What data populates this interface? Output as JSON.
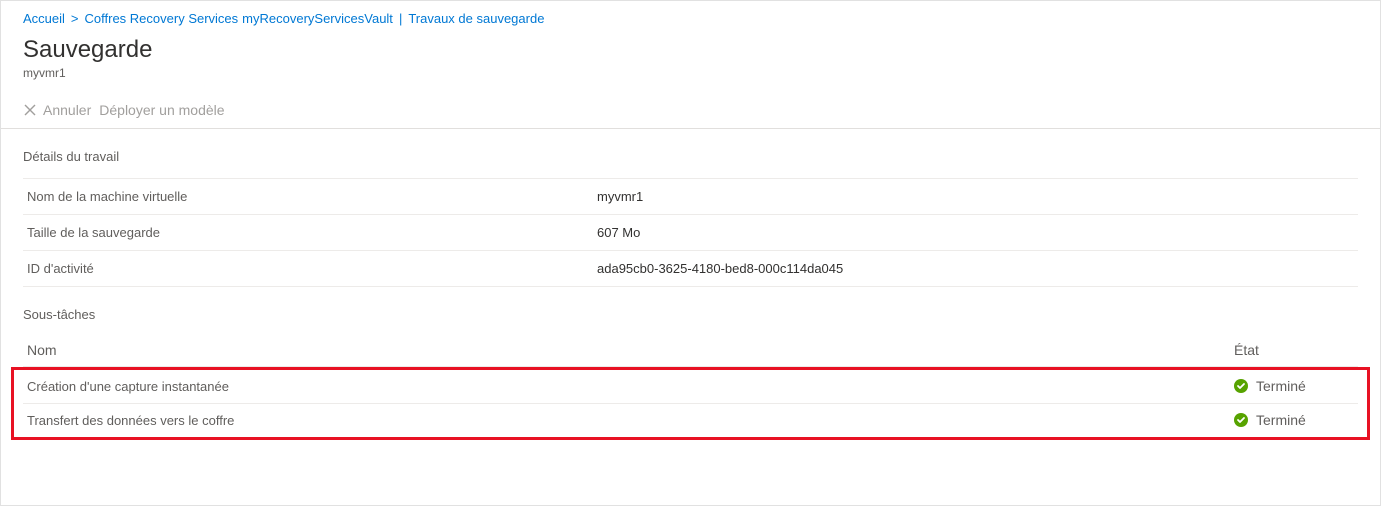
{
  "breadcrumb": {
    "home": "Accueil",
    "vaults": "Coffres Recovery Services",
    "vault_name": "myRecoveryServicesVault",
    "jobs": "Travaux de sauvegarde"
  },
  "page": {
    "title": "Sauvegarde",
    "subtitle": "myvmr1"
  },
  "toolbar": {
    "cancel_label": "Annuler",
    "deploy_template_label": "Déployer un modèle"
  },
  "details": {
    "section_title": "Détails du travail",
    "rows": [
      {
        "label": "Nom de la machine virtuelle",
        "value": "myvmr1"
      },
      {
        "label": "Taille de la sauvegarde",
        "value": "607 Mo"
      },
      {
        "label": "ID d'activité",
        "value": "ada95cb0-3625-4180-bed8-000c114da045"
      }
    ]
  },
  "subtasks": {
    "section_title": "Sous-tâches",
    "col_name": "Nom",
    "col_state": "État",
    "rows": [
      {
        "name": "Création d'une capture instantanée",
        "state": "Terminé"
      },
      {
        "name": "Transfert des données vers le coffre",
        "state": "Terminé"
      }
    ]
  },
  "colors": {
    "success": "#57A300",
    "highlight_border": "#e81123",
    "link": "#0078d4"
  }
}
